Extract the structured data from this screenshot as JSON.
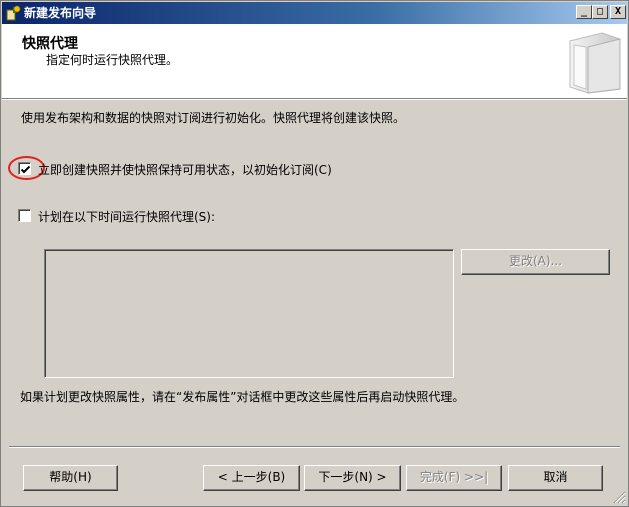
{
  "window": {
    "title": "新建发布向导",
    "minimize_glyph": "_",
    "maximize_glyph": "□",
    "close_glyph": "X"
  },
  "header": {
    "title": "快照代理",
    "subtitle": "指定何时运行快照代理。",
    "icon": "wizard-book-icon"
  },
  "body": {
    "intro": "使用发布架构和数据的快照对订阅进行初始化。快照代理将创建该快照。",
    "create_now": {
      "label": "立即创建快照并使快照保持可用状态，以初始化订阅(C)",
      "checked": true
    },
    "schedule": {
      "label": "计划在以下时间运行快照代理(S):",
      "checked": false
    },
    "change_button": "更改(A)...",
    "footer_note": "如果计划更改快照属性，请在“发布属性”对话框中更改这些属性后再启动快照代理。"
  },
  "buttons": {
    "help": "帮助(H)",
    "back": "< 上一步(B)",
    "next": "下一步(N) >",
    "finish": "完成(F) >>|",
    "cancel": "取消"
  },
  "colors": {
    "highlight_ring": "#e02020",
    "titlebar_start": "#0a246a",
    "titlebar_end": "#a6caf0"
  }
}
